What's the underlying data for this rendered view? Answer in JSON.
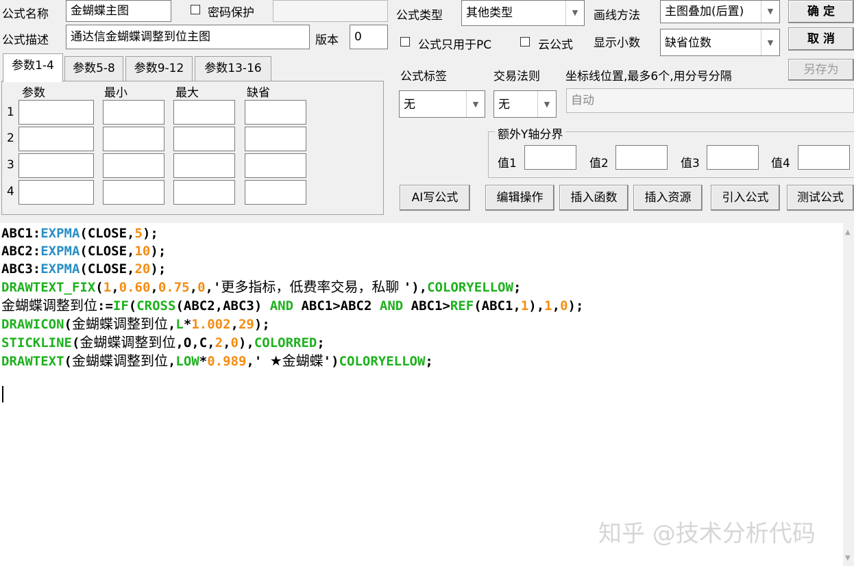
{
  "formula_name": {
    "label": "公式名称",
    "value": "金蝴蝶主图"
  },
  "password": {
    "label": "密码保护"
  },
  "formula_desc": {
    "label": "公式描述",
    "value": "通达信金蝴蝶调整到位主图"
  },
  "version": {
    "label": "版本",
    "value": "0"
  },
  "formula_type": {
    "label": "公式类型",
    "value": "其他类型"
  },
  "draw_method": {
    "label": "画线方法",
    "value": "主图叠加(后置)"
  },
  "pc_only": {
    "label": "公式只用于PC"
  },
  "cloud": {
    "label": "云公式"
  },
  "decimals": {
    "label": "显示小数",
    "value": "缺省位数"
  },
  "buttons": {
    "ok": "确 定",
    "cancel": "取 消",
    "save_as": "另存为"
  },
  "tabs": [
    "参数1-4",
    "参数5-8",
    "参数9-12",
    "参数13-16"
  ],
  "params": {
    "headers": [
      "参数",
      "最小",
      "最大",
      "缺省"
    ],
    "rows": [
      "1",
      "2",
      "3",
      "4"
    ]
  },
  "formula_tag": {
    "label": "公式标签",
    "value": "无"
  },
  "trade_rule": {
    "label": "交易法则",
    "value": "无"
  },
  "coord_lines": {
    "label": "坐标线位置,最多6个,用分号分隔",
    "value": "自动"
  },
  "extra_y": {
    "title": "额外Y轴分界",
    "labels": [
      "值1",
      "值2",
      "值3",
      "值4"
    ]
  },
  "actions": [
    "AI写公式",
    "编辑操作",
    "插入函数",
    "插入资源",
    "引入公式",
    "测试公式"
  ],
  "code": {
    "l1": [
      "ABC1:",
      "EXPMA",
      "(CLOSE,",
      "5",
      ");"
    ],
    "l2": [
      "ABC2:",
      "EXPMA",
      "(CLOSE,",
      "10",
      ");"
    ],
    "l3": [
      "ABC3:",
      "EXPMA",
      "(CLOSE,",
      "20",
      ");"
    ],
    "l4": [
      "DRAWTEXT_FIX",
      "(",
      "1",
      ",",
      "0.60",
      ",",
      "0.75",
      ",",
      "0",
      ",'",
      "更多指标，低费率交易，私聊 ",
      "'),",
      "COLORYELLOW",
      ";"
    ],
    "l5": [
      "金蝴蝶调整到位",
      ":=",
      "IF",
      "(",
      "CROSS",
      "(ABC2,ABC3) ",
      "AND",
      " ABC1>ABC2 ",
      "AND",
      " ABC1>",
      "REF",
      "(ABC1,",
      "1",
      "),",
      "1",
      ",",
      "0",
      ");"
    ],
    "l6": [
      "DRAWICON",
      "(",
      "金蝴蝶调整到位",
      ",",
      "L",
      "*",
      "1.002",
      ",",
      "29",
      ");"
    ],
    "l7": [
      "STICKLINE",
      "(",
      "金蝴蝶调整到位",
      ",O,C,",
      "2",
      ",",
      "0",
      "),",
      "COLORRED",
      ";"
    ],
    "l8": [
      "DRAWTEXT",
      "(",
      "金蝴蝶调整到位",
      ",",
      "LOW",
      "*",
      "0.989",
      ",' ",
      "★金蝴蝶",
      "')",
      "COLORYELLOW",
      ";"
    ]
  },
  "watermark": "知乎 @技术分析代码"
}
